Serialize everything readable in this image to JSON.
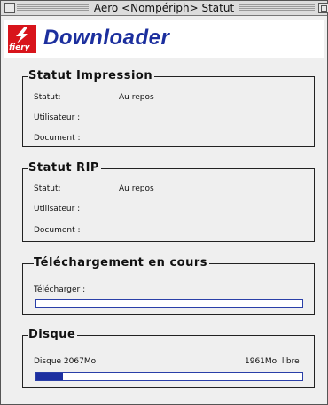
{
  "window": {
    "title": "Aero <Nompériph> Statut"
  },
  "header": {
    "logo_text": "fiery",
    "app_title": "Downloader"
  },
  "print_status": {
    "heading": "Statut Impression",
    "status_label": "Statut:",
    "status_value": "Au repos",
    "user_label": "Utilisateur :",
    "document_label": "Document :"
  },
  "rip_status": {
    "heading": "Statut RIP",
    "status_label": "Statut:",
    "status_value": "Au repos",
    "user_label": "Utilisateur :",
    "document_label": "Document :"
  },
  "download": {
    "heading": "Téléchargement en cours",
    "download_label": "Télécharger :",
    "progress_fraction": 0
  },
  "disk": {
    "heading": "Disque",
    "total_label": "Disque 2067Mo",
    "free_label": "1961Mo  libre",
    "used_fraction": 0.1
  },
  "colors": {
    "accent": "#1c2fa0",
    "logo": "#d8141b",
    "title_text": "#1c2f9e"
  }
}
